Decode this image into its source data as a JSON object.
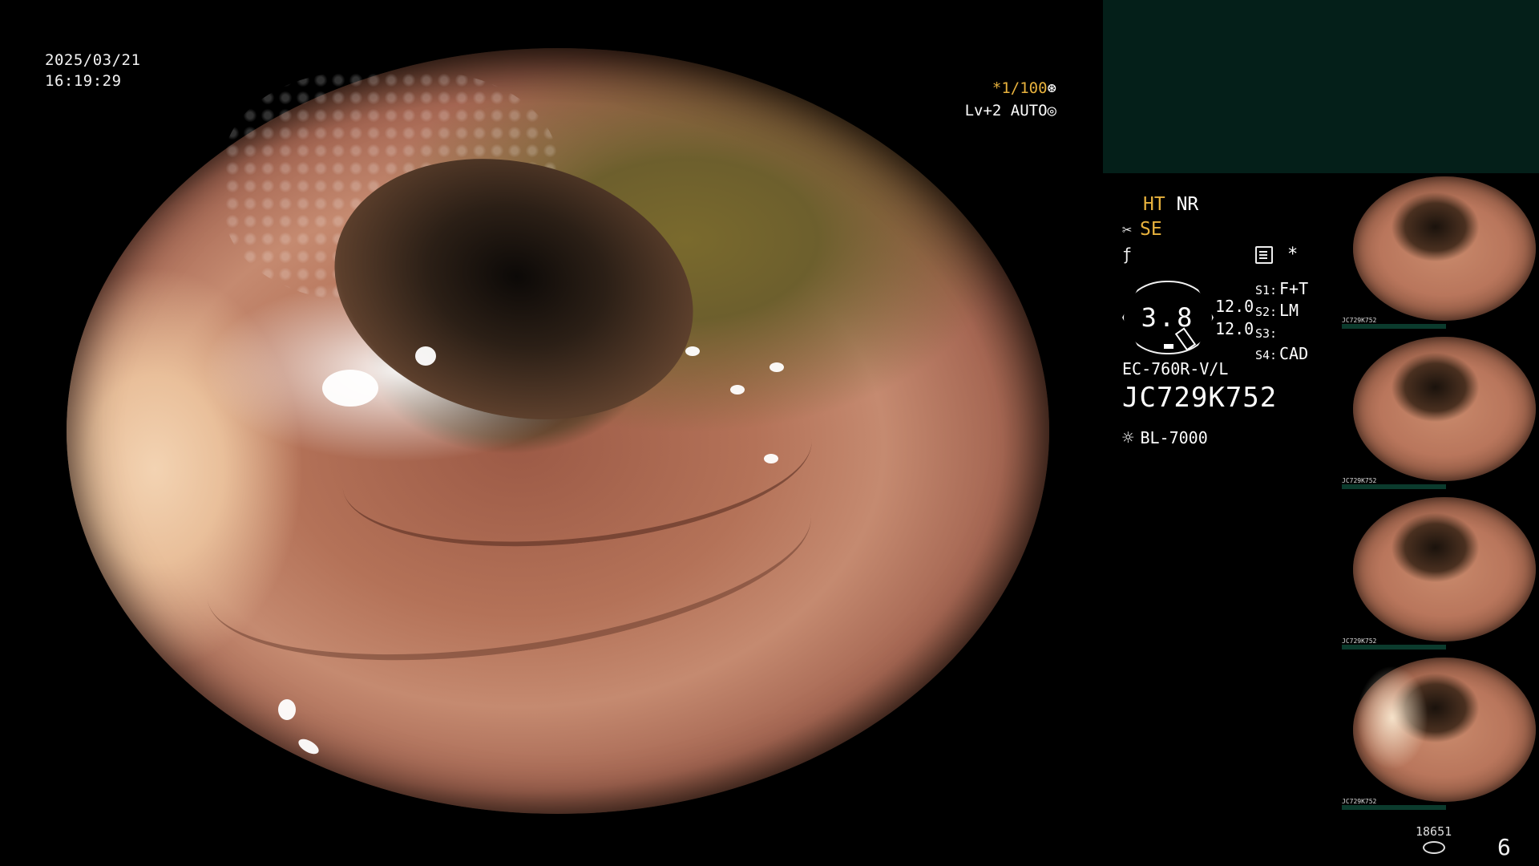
{
  "datetime": {
    "date": "2025/03/21",
    "time": "16:19:29"
  },
  "scope_status": {
    "shutter": "*1/100",
    "shutter_icon": "aperture-icon",
    "level": "Lv+2 AUTO",
    "level_icon": "iris-icon"
  },
  "panel": {
    "ht": "HT",
    "nr": "NR",
    "se_icon": "scissors-icon",
    "se": "SE",
    "aux_icon": "cursive-f-icon",
    "memo_icon": "memo-icon",
    "asterisk": "*",
    "gauge_value": "3.8",
    "value_1": "12.0",
    "value_2": "12.0",
    "slots": [
      {
        "key": "S1:",
        "value": "F+T"
      },
      {
        "key": "S2:",
        "value": "LM"
      },
      {
        "key": "S3:",
        "value": ""
      },
      {
        "key": "S4:",
        "value": "CAD"
      }
    ],
    "model": "EC-760R-V/L",
    "serial": "JC729K752",
    "light_icon": "sun-icon",
    "light_source": "BL-7000"
  },
  "thumbnails": [
    {
      "label": "JC729K752"
    },
    {
      "label": "JC729K752"
    },
    {
      "label": "JC729K752"
    },
    {
      "label": "JC729K752"
    }
  ],
  "footer": {
    "counter": "18651",
    "counter_icon": "disk-icon",
    "page": "6"
  },
  "colors": {
    "accent": "#e8b23d",
    "panel_top": "#041f19"
  }
}
